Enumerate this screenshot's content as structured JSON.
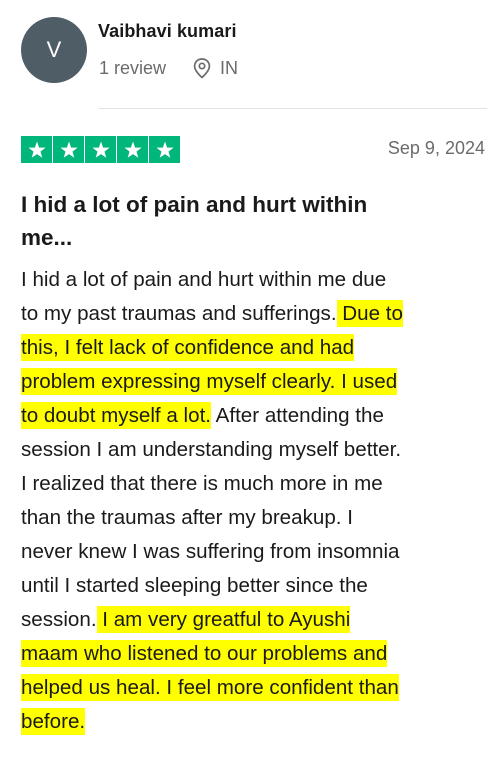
{
  "reviewer": {
    "initial": "V",
    "name": "Vaibhavi kumari",
    "review_count": "1 review",
    "country": "IN",
    "avatar_color": "#4e5d66"
  },
  "rating": {
    "stars": 5,
    "max_stars": 5,
    "color": "#00b67a"
  },
  "review": {
    "date": "Sep 9, 2024",
    "title_lines": [
      "I hid a lot of pain and hurt within",
      "me..."
    ],
    "highlight_color": "#ffff00",
    "body_lines": [
      [
        {
          "t": "I hid a lot of pain and hurt within me due",
          "hl": false
        }
      ],
      [
        {
          "t": "to my past traumas and sufferings.",
          "hl": false
        },
        {
          "t": " Due to",
          "hl": true
        }
      ],
      [
        {
          "t": "this, I felt lack of confidence and had",
          "hl": true
        }
      ],
      [
        {
          "t": "problem expressing myself clearly. I used",
          "hl": true
        }
      ],
      [
        {
          "t": "to doubt myself a lot.",
          "hl": true
        },
        {
          "t": " After attending the",
          "hl": false
        }
      ],
      [
        {
          "t": "session I am understanding myself better.",
          "hl": false
        }
      ],
      [
        {
          "t": "I realized that there is much more in me",
          "hl": false
        }
      ],
      [
        {
          "t": "than the traumas after my breakup. I",
          "hl": false
        }
      ],
      [
        {
          "t": "never knew I was suffering from insomnia",
          "hl": false
        }
      ],
      [
        {
          "t": "until I started sleeping better since the",
          "hl": false
        }
      ],
      [
        {
          "t": "session.",
          "hl": false
        },
        {
          "t": " I am very greatful to Ayushi",
          "hl": true
        }
      ],
      [
        {
          "t": "maam who listened to our problems and",
          "hl": true
        }
      ],
      [
        {
          "t": "helped us heal. I feel more confident than",
          "hl": true
        }
      ],
      [
        {
          "t": "before.",
          "hl": true
        }
      ]
    ]
  },
  "icons": {
    "location": "map-pin-icon",
    "star": "star-icon"
  }
}
